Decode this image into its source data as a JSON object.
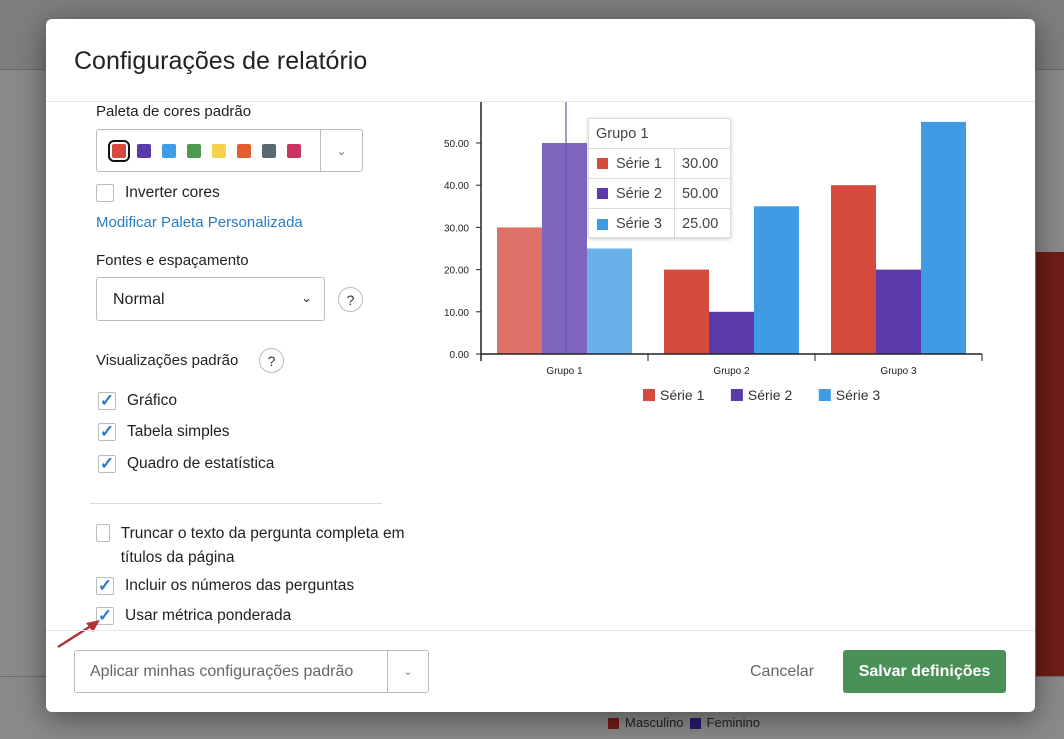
{
  "dialog": {
    "title": "Configurações de relatório"
  },
  "palette": {
    "label": "Paleta de cores padrão",
    "colors": [
      "#d64a3e",
      "#5b3aab",
      "#3f9be3",
      "#4f9a52",
      "#f5d24e",
      "#e45f30",
      "#586770",
      "#c9345f"
    ],
    "selected_index": 0
  },
  "invert": {
    "label": "Inverter cores",
    "checked": false
  },
  "modify_link": "Modificar Paleta Personalizada",
  "fonts": {
    "label": "Fontes e espaçamento",
    "value": "Normal",
    "help": "?"
  },
  "views": {
    "label": "Visualizações padrão",
    "help": "?",
    "items": [
      {
        "label": "Gráfico",
        "checked": true
      },
      {
        "label": "Tabela simples",
        "checked": true
      },
      {
        "label": "Quadro de estatística",
        "checked": true
      }
    ]
  },
  "options": [
    {
      "label": "Truncar o texto da pergunta completa em títulos da página",
      "checked": false
    },
    {
      "label": "Incluir os números das perguntas",
      "checked": true
    },
    {
      "label": "Usar métrica ponderada",
      "checked": true
    }
  ],
  "footer": {
    "apply": "Aplicar minhas configurações padrão",
    "cancel": "Cancelar",
    "save": "Salvar definições"
  },
  "background": {
    "legend": [
      "Masculino",
      "Feminino"
    ],
    "legend_colors": [
      "#6f1d18",
      "#2a1a6e"
    ]
  },
  "tooltip": {
    "title": "Grupo 1",
    "rows": [
      {
        "name": "Série 1",
        "value": "30.00"
      },
      {
        "name": "Série 2",
        "value": "50.00"
      },
      {
        "name": "Série 3",
        "value": "25.00"
      }
    ]
  },
  "chart_data": {
    "type": "bar",
    "categories": [
      "Grupo 1",
      "Grupo 2",
      "Grupo 3"
    ],
    "series": [
      {
        "name": "Série 1",
        "color": "#d64a3e",
        "values": [
          30,
          20,
          40
        ]
      },
      {
        "name": "Série 2",
        "color": "#5b3aab",
        "values": [
          50,
          10,
          20
        ]
      },
      {
        "name": "Série 3",
        "color": "#3f9be3",
        "values": [
          25,
          35,
          55
        ]
      }
    ],
    "yticks": [
      "0.00",
      "10.00",
      "20.00",
      "30.00",
      "40.00",
      "50.00"
    ],
    "ylim": [
      0,
      55
    ],
    "legend": "bottom",
    "highlighted_category": "Grupo 1"
  }
}
